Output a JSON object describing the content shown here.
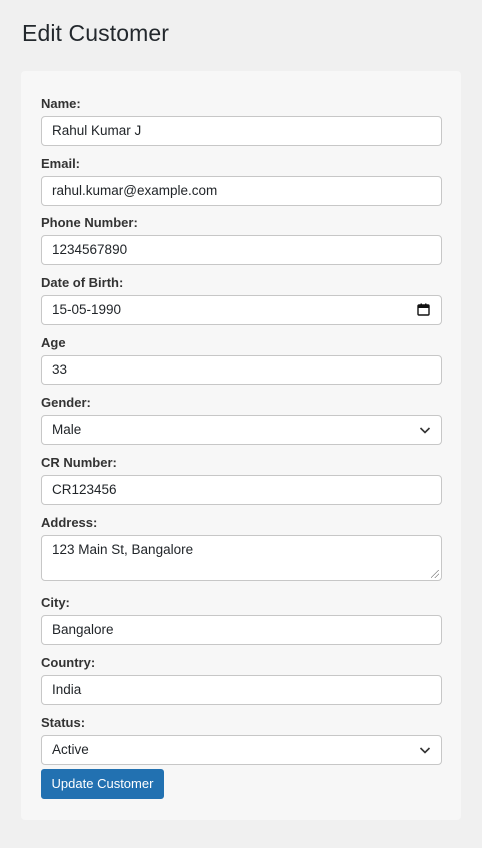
{
  "page": {
    "title": "Edit Customer"
  },
  "form": {
    "name": {
      "label": "Name:",
      "value": "Rahul Kumar J"
    },
    "email": {
      "label": "Email:",
      "value": "rahul.kumar@example.com"
    },
    "phone": {
      "label": "Phone Number:",
      "value": "1234567890"
    },
    "dob": {
      "label": "Date of Birth:",
      "value": "15-05-1990"
    },
    "age": {
      "label": "Age",
      "value": "33"
    },
    "gender": {
      "label": "Gender:",
      "value": "Male"
    },
    "cr": {
      "label": "CR Number:",
      "value": "CR123456"
    },
    "address": {
      "label": "Address:",
      "value": "123 Main St, Bangalore"
    },
    "city": {
      "label": "City:",
      "value": "Bangalore"
    },
    "country": {
      "label": "Country:",
      "value": "India"
    },
    "status": {
      "label": "Status:",
      "value": "Active"
    },
    "submit_label": "Update Customer"
  },
  "icons": {
    "calendar": "calendar-icon",
    "chevron": "chevron-down-icon"
  },
  "colors": {
    "accent": "#2271b1",
    "background": "#f0f0f0",
    "card": "#f7f7f7"
  }
}
